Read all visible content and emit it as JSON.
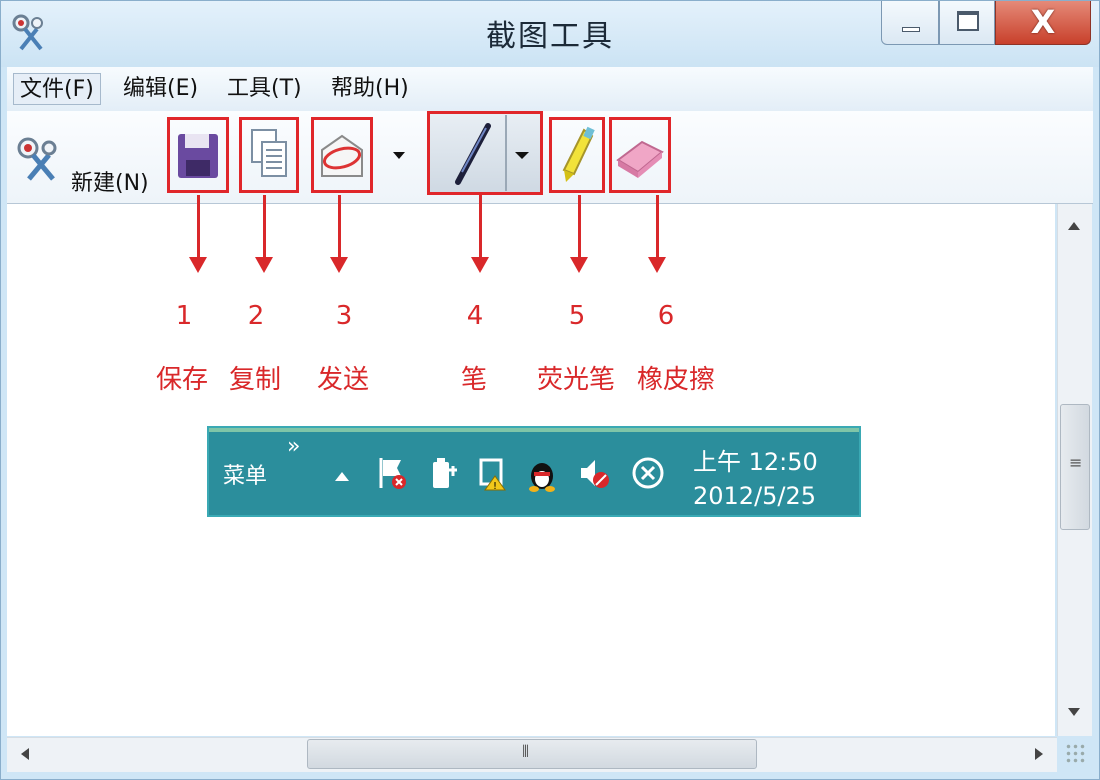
{
  "window": {
    "title": "截图工具"
  },
  "menu": {
    "items": [
      "文件(F)",
      "编辑(E)",
      "工具(T)",
      "帮助(H)"
    ]
  },
  "toolbar": {
    "new_label": "新建(N)"
  },
  "annotations": [
    {
      "number": "1",
      "label": "保存"
    },
    {
      "number": "2",
      "label": "复制"
    },
    {
      "number": "3",
      "label": "发送"
    },
    {
      "number": "4",
      "label": "笔"
    },
    {
      "number": "5",
      "label": "荧光笔"
    },
    {
      "number": "6",
      "label": "橡皮擦"
    }
  ],
  "taskbar": {
    "menu_label": "菜单",
    "chevron": "»",
    "time": "上午 12:50",
    "date": "2012/5/25"
  },
  "colors": {
    "annotation": "#d9282a",
    "taskbar": "#2b8e9c",
    "close_button": "#c8402b"
  },
  "icons": [
    "scissors-icon",
    "save-icon",
    "copy-icon",
    "send-icon",
    "pen-icon",
    "highlighter-icon",
    "eraser-icon",
    "flag-icon",
    "battery-icon",
    "network-icon",
    "qq-icon",
    "volume-icon",
    "close-circle-icon"
  ]
}
